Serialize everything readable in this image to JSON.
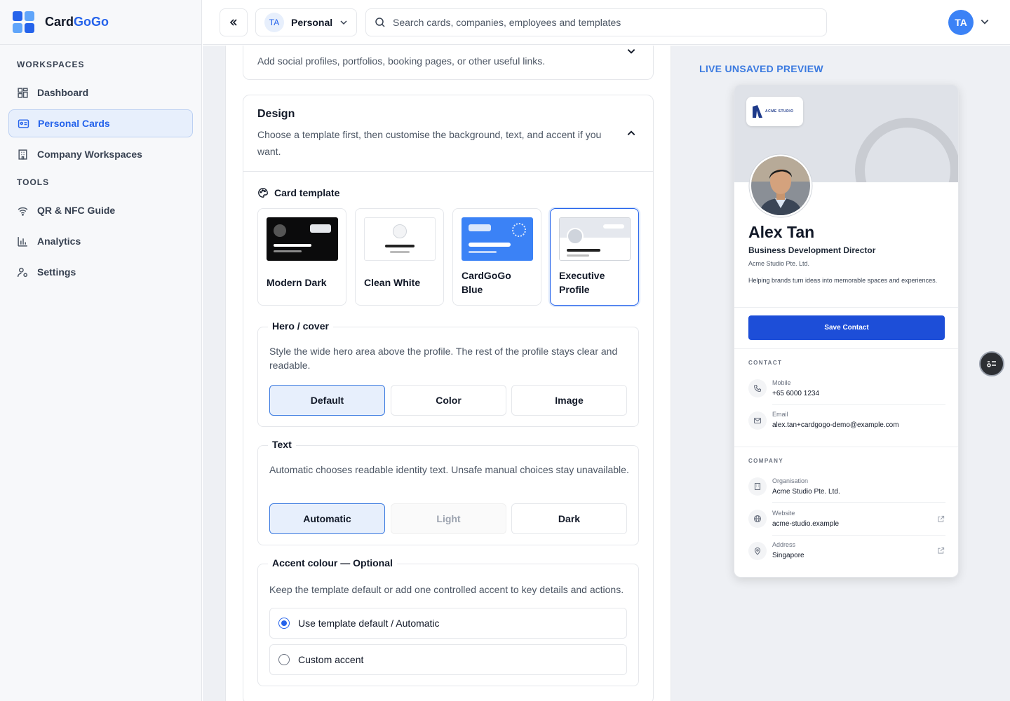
{
  "brand": {
    "name_part1": "Card",
    "name_part2": "GoGo"
  },
  "sidebar": {
    "workspaces_label": "WORKSPACES",
    "tools_label": "TOOLS",
    "items": [
      {
        "label": "Dashboard",
        "icon": "dashboard-icon"
      },
      {
        "label": "Personal Cards",
        "icon": "id-card-icon",
        "active": true
      },
      {
        "label": "Company Workspaces",
        "icon": "building-icon"
      },
      {
        "label": "QR & NFC Guide",
        "icon": "wifi-icon"
      },
      {
        "label": "Analytics",
        "icon": "bar-chart-icon"
      },
      {
        "label": "Settings",
        "icon": "user-settings-icon"
      }
    ]
  },
  "topbar": {
    "workspace_initials": "TA",
    "workspace_label": "Personal",
    "search_placeholder": "Search cards, companies, employees and templates",
    "user_initials": "TA"
  },
  "links_section": {
    "description": "Add social profiles, portfolios, booking pages, or other useful links."
  },
  "design": {
    "title": "Design",
    "description": "Choose a template first, then customise the background, text, and accent if you want.",
    "card_template_label": "Card template",
    "templates": [
      {
        "name": "Modern Dark"
      },
      {
        "name": "Clean White"
      },
      {
        "name": "CardGoGo Blue"
      },
      {
        "name": "Executive Profile",
        "selected": true
      }
    ],
    "hero": {
      "legend": "Hero / cover",
      "description": "Style the wide hero area above the profile. The rest of the profile stays clear and readable.",
      "options": [
        "Default",
        "Color",
        "Image"
      ],
      "selected": "Default"
    },
    "text": {
      "legend": "Text",
      "description": "Automatic chooses readable identity text. Unsafe manual choices stay unavailable.",
      "options": [
        "Automatic",
        "Light",
        "Dark"
      ],
      "selected": "Automatic",
      "disabled": "Light"
    },
    "accent": {
      "legend": "Accent colour — Optional",
      "description": "Keep the template default or add one controlled accent to key details and actions.",
      "options": [
        "Use template default / Automatic",
        "Custom accent"
      ],
      "selected": "Use template default / Automatic"
    }
  },
  "preview": {
    "label": "LIVE UNSAVED PREVIEW",
    "logo_text": "ACME STUDIO",
    "name": "Alex Tan",
    "title": "Business Development Director",
    "company": "Acme Studio Pte. Ltd.",
    "bio": "Helping brands turn ideas into memorable spaces and experiences.",
    "save_button": "Save Contact",
    "contact_label": "CONTACT",
    "mobile_label": "Mobile",
    "mobile_value": "+65 6000 1234",
    "email_label": "Email",
    "email_value": "alex.tan+cardgogo-demo@example.com",
    "company_label": "COMPANY",
    "org_label": "Organisation",
    "org_value": "Acme Studio Pte. Ltd.",
    "website_label": "Website",
    "website_value": "acme-studio.example",
    "address_label": "Address",
    "address_value": "Singapore"
  },
  "colors": {
    "accent": "#2563eb",
    "save_button": "#1d4ed8",
    "preview_label": "#3b7ae0"
  }
}
